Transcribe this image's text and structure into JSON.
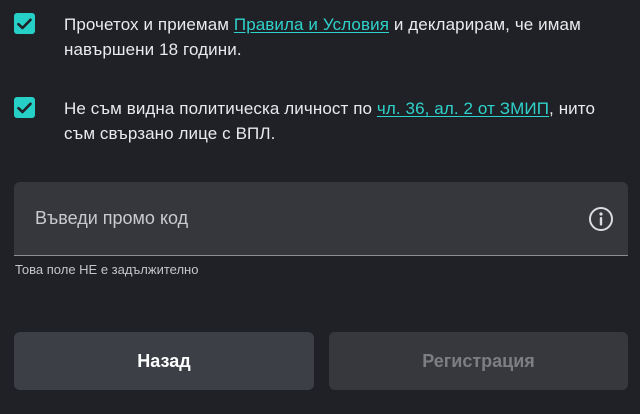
{
  "consents": [
    {
      "checked": true,
      "text_before": "Прочетох и приемам ",
      "link_text": "Правила и Условия",
      "text_after": " и декларирам, че имам навършени 18 години."
    },
    {
      "checked": true,
      "text_before": "Не съм видна политическа личност по ",
      "link_text": "чл. 36, ал. 2 от ЗМИП",
      "text_after": ", нито съм свързано лице с ВПЛ."
    }
  ],
  "promo": {
    "placeholder": "Въведи промо код",
    "value": "",
    "helper": "Това поле НЕ е задължително",
    "icon": "info-icon"
  },
  "buttons": {
    "back_label": "Назад",
    "register_label": "Регистрация",
    "register_enabled": false
  },
  "colors": {
    "background": "#1f2126",
    "accent": "#27d0c7",
    "link": "#2fd2cb",
    "field_bg": "#35373d",
    "button_bg": "#3c3f45",
    "disabled_text": "#7c7e83"
  }
}
